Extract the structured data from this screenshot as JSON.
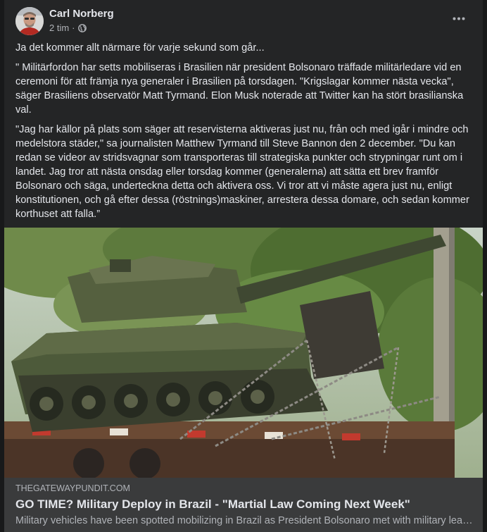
{
  "post": {
    "author": "Carl Norberg",
    "time": "2 tim",
    "separator": "·",
    "audience_icon": "globe-icon",
    "more_icon": "more-options-icon",
    "paragraphs": [
      "Ja det kommer allt närmare för varje sekund som går...",
      "\" Militärfordon har setts mobiliseras i Brasilien när president Bolsonaro träffade militärledare vid en ceremoni för att främja nya generaler i Brasilien på torsdagen. \"Krigslagar kommer nästa vecka\", säger Brasiliens observatör Matt Tyrmand. Elon Musk noterade att Twitter kan ha stört brasilianska val.",
      "\"Jag har källor på plats som säger att reservisterna aktiveras just nu, från och med igår i mindre och medelstora städer,\" sa journalisten Matthew Tyrmand till Steve Bannon den 2 december. \"Du kan redan se videor av stridsvagnar som transporteras till strategiska punkter och strypningar runt om i landet. Jag tror att nästa onsdag eller torsdag kommer (generalerna) att sätta ett brev framför Bolsonaro och säga, underteckna detta och aktivera oss. Vi tror att vi måste agera just nu, enligt konstitutionen, och gå efter dessa (röstnings)maskiner, arrestera dessa domare, och sedan kommer korthuset att falla.”"
    ]
  },
  "link": {
    "domain": "THEGATEWAYPUNDIT.COM",
    "title": "GO TIME? Military Deploy in Brazil - \"Martial Law Coming Next Week\"",
    "description": "Military vehicles have been spotted mobilizing in Brazil as President Bolsonaro met with military leaders at a ceremony to promote new generals in Brazil on Thursday."
  },
  "colors": {
    "page_background": "#18191a",
    "card_background": "#242526",
    "link_background": "#3a3b3c",
    "primary_text": "#e4e6eb",
    "secondary_text": "#b0b3b8",
    "tank_green": "#4d5a3a"
  }
}
